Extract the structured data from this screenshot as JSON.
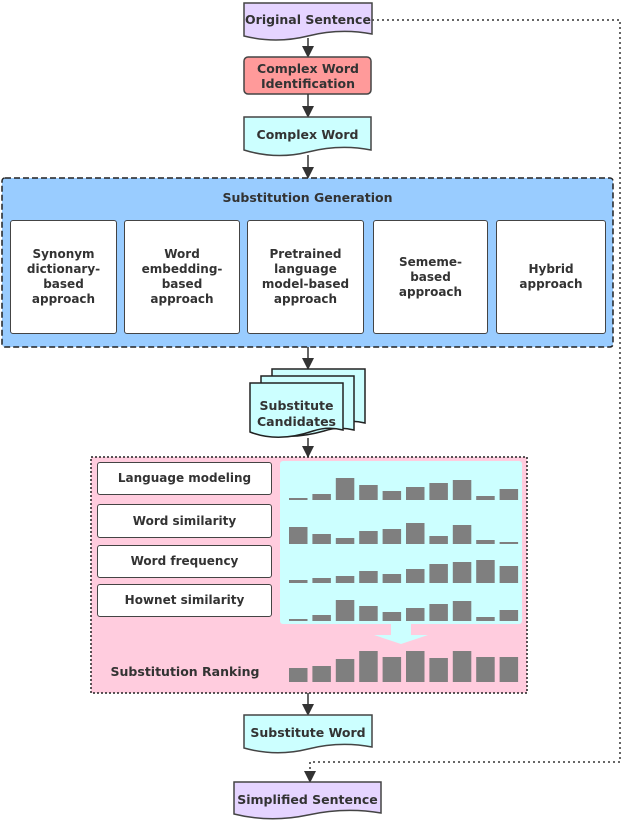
{
  "nodes": {
    "original": "Original Sentence",
    "cwi": "Complex Word Identification",
    "complex_word": "Complex Word",
    "generation_title": "Substitution Generation",
    "approaches": [
      "Synonym dictionary-based approach",
      "Word embedding-based approach",
      "Pretrained language model-based approach",
      "Sememe-based approach",
      "Hybrid approach"
    ],
    "candidates": "Substitute Candidates",
    "ranking_title": "Substitution Ranking",
    "features": [
      "Language modeling",
      "Word similarity",
      "Word frequency",
      "Hownet similarity"
    ],
    "substitute_word": "Substitute Word",
    "simplified": "Simplified Sentence"
  },
  "bars": {
    "features": [
      [
        2,
        6,
        22,
        15,
        9,
        13,
        17,
        20,
        4,
        11
      ],
      [
        17,
        10,
        6,
        13,
        15,
        21,
        8,
        19,
        4,
        2
      ],
      [
        3,
        5,
        7,
        12,
        9,
        14,
        19,
        21,
        23,
        17
      ],
      [
        2,
        6,
        21,
        15,
        9,
        13,
        17,
        20,
        4,
        11
      ]
    ],
    "ranking": [
      14,
      16,
      23,
      31,
      25,
      31,
      24,
      31,
      25,
      25
    ]
  },
  "colors": {
    "original": "#e5d4ff",
    "cwi": "#ff9a9a",
    "word": "#ccffff",
    "generation": "#99ccff",
    "ranking": "#ffccde",
    "feature_area": "#ccffff",
    "bar": "#7f7f7f"
  }
}
